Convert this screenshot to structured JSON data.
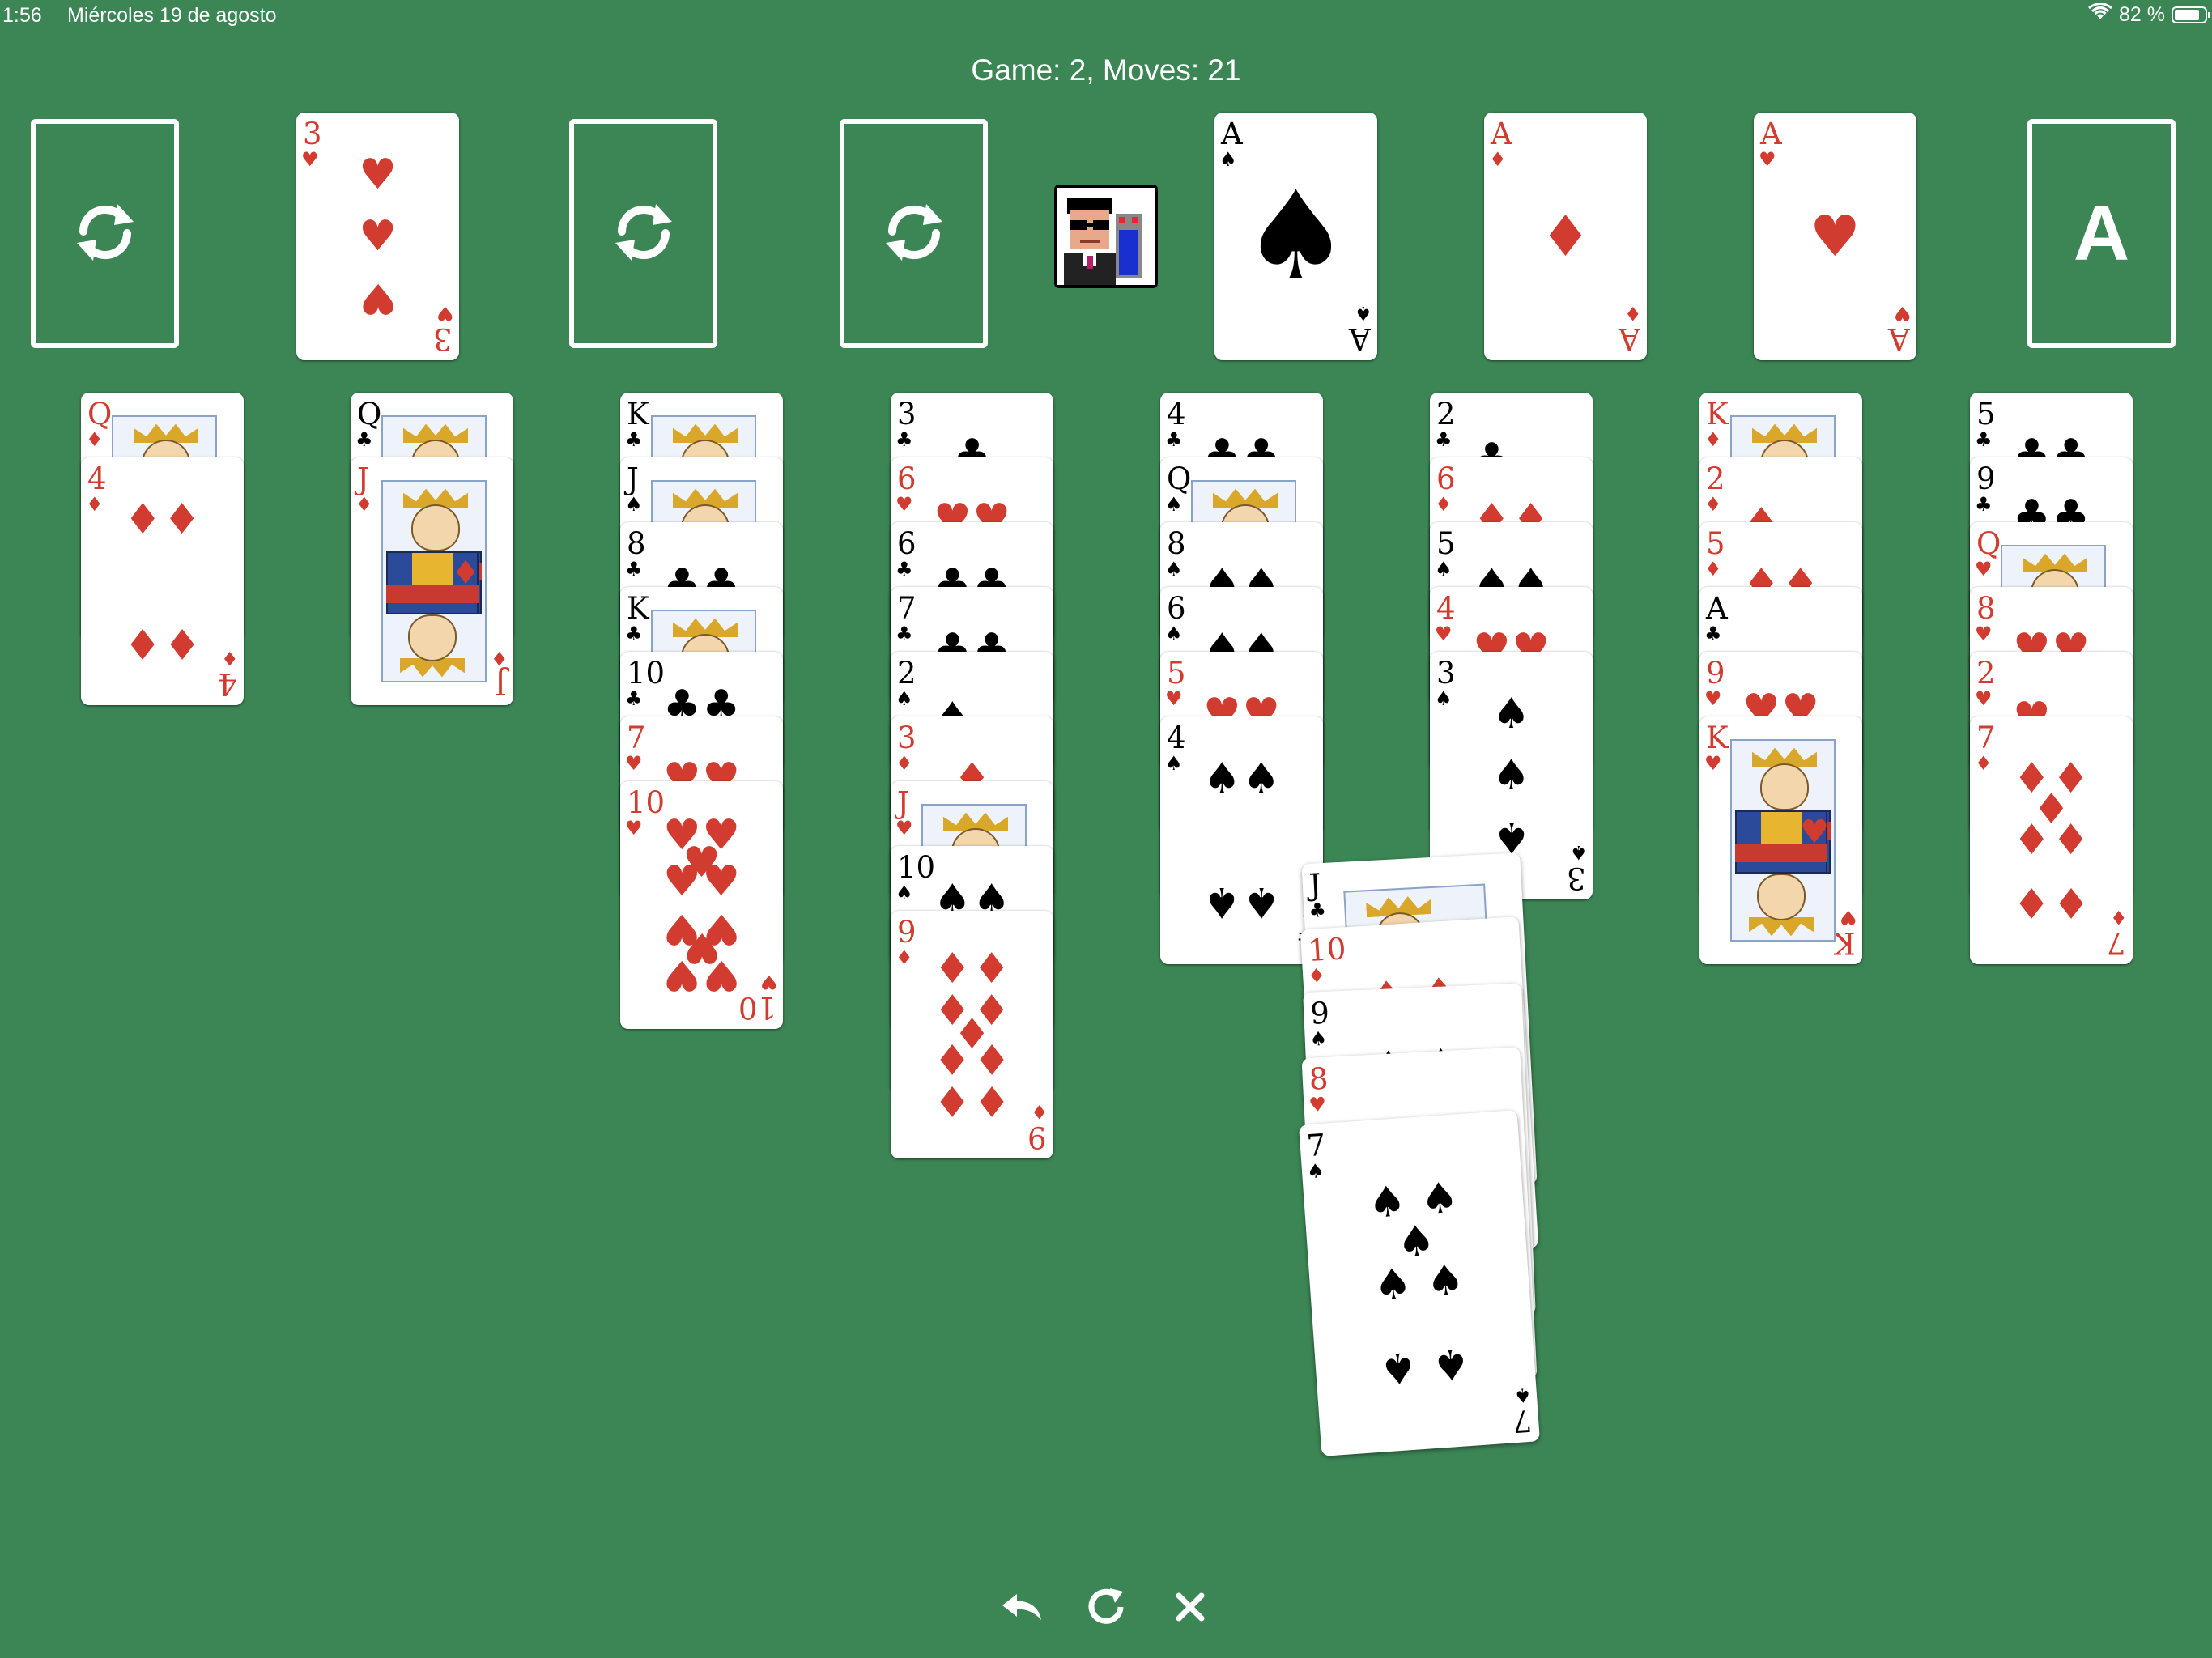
{
  "status_bar": {
    "time": "1:56",
    "date": "Miércoles 19 de agosto",
    "battery": "82 %",
    "battery_level": 0.82
  },
  "game": {
    "title": "Game: 2, Moves: 21"
  },
  "colors": {
    "felt": "#3c8655",
    "red_suit": "#d23b2f",
    "black_suit": "#000000"
  },
  "top_row": [
    {
      "kind": "stock-slot",
      "icon": "recycle-icon"
    },
    {
      "kind": "card",
      "rank": "3",
      "suit": "hearts"
    },
    {
      "kind": "stock-slot",
      "icon": "recycle-icon"
    },
    {
      "kind": "stock-slot",
      "icon": "recycle-icon"
    },
    {
      "kind": "avatar",
      "icon": "player-avatar-icon"
    },
    {
      "kind": "card",
      "rank": "A",
      "suit": "spades"
    },
    {
      "kind": "card",
      "rank": "A",
      "suit": "diamonds"
    },
    {
      "kind": "card",
      "rank": "A",
      "suit": "hearts"
    },
    {
      "kind": "foundation-slot",
      "label": "A"
    }
  ],
  "tableau": [
    [
      {
        "rank": "Q",
        "suit": "diamonds"
      },
      {
        "rank": "4",
        "suit": "diamonds"
      }
    ],
    [
      {
        "rank": "Q",
        "suit": "clubs"
      },
      {
        "rank": "J",
        "suit": "diamonds"
      }
    ],
    [
      {
        "rank": "K",
        "suit": "clubs"
      },
      {
        "rank": "J",
        "suit": "spades"
      },
      {
        "rank": "8",
        "suit": "clubs"
      },
      {
        "rank": "K",
        "suit": "clubs"
      },
      {
        "rank": "10",
        "suit": "clubs"
      },
      {
        "rank": "7",
        "suit": "hearts"
      },
      {
        "rank": "10",
        "suit": "hearts"
      }
    ],
    [
      {
        "rank": "3",
        "suit": "clubs"
      },
      {
        "rank": "6",
        "suit": "hearts"
      },
      {
        "rank": "6",
        "suit": "clubs"
      },
      {
        "rank": "7",
        "suit": "clubs"
      },
      {
        "rank": "2",
        "suit": "spades"
      },
      {
        "rank": "3",
        "suit": "diamonds"
      },
      {
        "rank": "J",
        "suit": "hearts"
      },
      {
        "rank": "10",
        "suit": "spades"
      },
      {
        "rank": "9",
        "suit": "diamonds"
      }
    ],
    [
      {
        "rank": "4",
        "suit": "clubs"
      },
      {
        "rank": "Q",
        "suit": "spades"
      },
      {
        "rank": "8",
        "suit": "spades"
      },
      {
        "rank": "6",
        "suit": "spades"
      },
      {
        "rank": "5",
        "suit": "hearts"
      },
      {
        "rank": "4",
        "suit": "spades"
      }
    ],
    [
      {
        "rank": "2",
        "suit": "clubs"
      },
      {
        "rank": "6",
        "suit": "diamonds"
      },
      {
        "rank": "5",
        "suit": "spades"
      },
      {
        "rank": "4",
        "suit": "hearts"
      },
      {
        "rank": "3",
        "suit": "spades"
      }
    ],
    [
      {
        "rank": "K",
        "suit": "diamonds"
      },
      {
        "rank": "2",
        "suit": "diamonds"
      },
      {
        "rank": "5",
        "suit": "diamonds"
      },
      {
        "rank": "A",
        "suit": "clubs"
      },
      {
        "rank": "9",
        "suit": "hearts"
      },
      {
        "rank": "K",
        "suit": "hearts"
      }
    ],
    [
      {
        "rank": "5",
        "suit": "clubs"
      },
      {
        "rank": "9",
        "suit": "clubs"
      },
      {
        "rank": "Q",
        "suit": "hearts"
      },
      {
        "rank": "8",
        "suit": "hearts"
      },
      {
        "rank": "2",
        "suit": "hearts"
      },
      {
        "rank": "7",
        "suit": "diamonds"
      }
    ]
  ],
  "dragged_stack": [
    {
      "rank": "J",
      "suit": "clubs"
    },
    {
      "rank": "10",
      "suit": "diamonds"
    },
    {
      "rank": "9",
      "suit": "spades"
    },
    {
      "rank": "8",
      "suit": "hearts"
    },
    {
      "rank": "7",
      "suit": "spades"
    }
  ],
  "toolbar": [
    {
      "name": "undo-button",
      "icon": "undo-arrow-icon",
      "glyph": "↶"
    },
    {
      "name": "restart-button",
      "icon": "restart-icon",
      "glyph": "↻"
    },
    {
      "name": "close-button",
      "icon": "close-icon",
      "glyph": "✕"
    }
  ]
}
